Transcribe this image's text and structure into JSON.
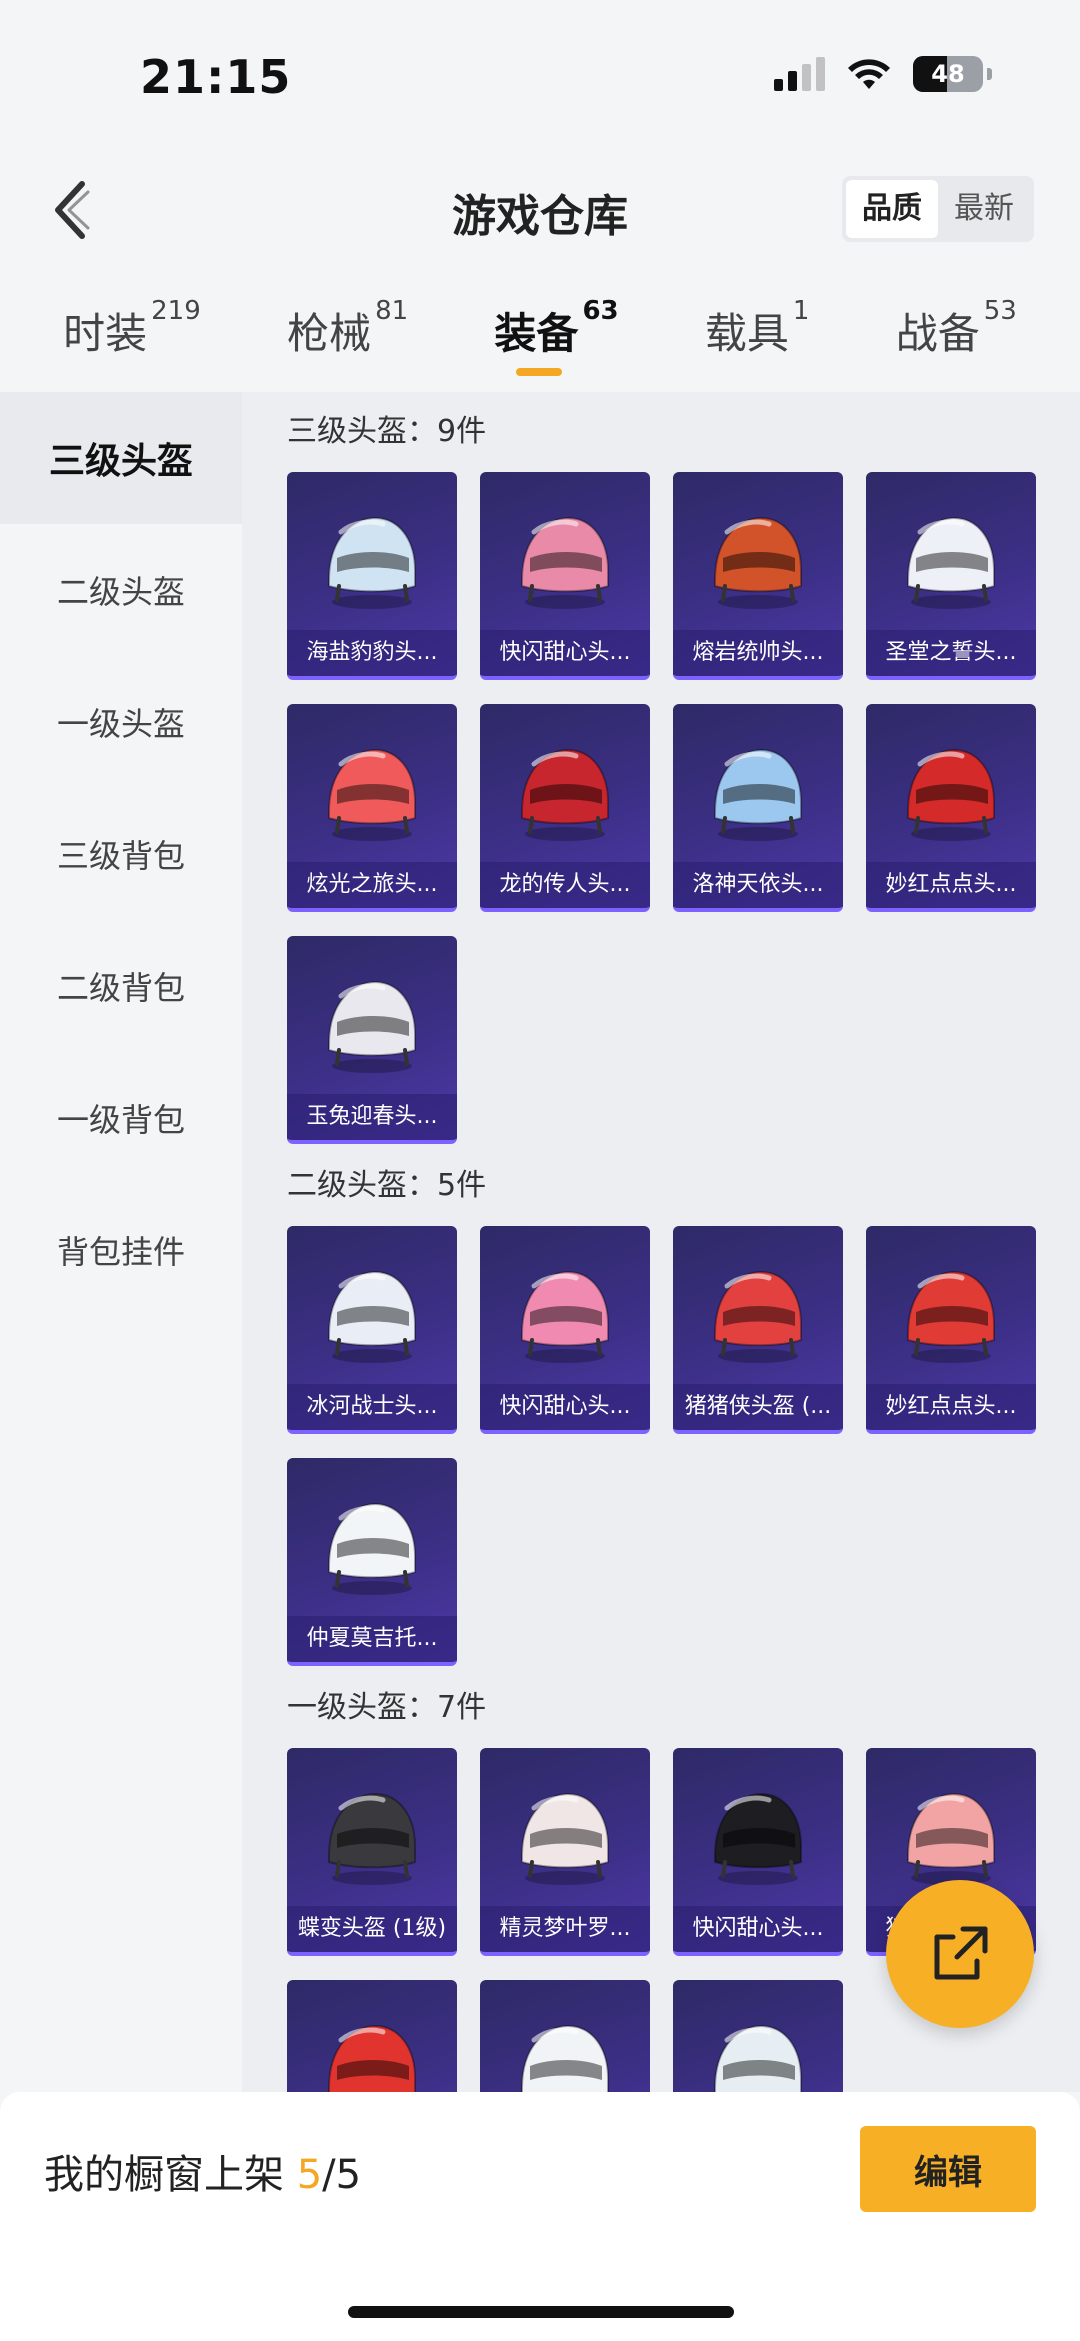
{
  "status_bar": {
    "time": "21:15",
    "battery": "48",
    "battery_level": 0.48
  },
  "header": {
    "title": "游戏仓库",
    "sort_options": [
      "品质",
      "最新"
    ],
    "sort_active": "品质"
  },
  "tabs": [
    {
      "label": "时装",
      "count": "219",
      "active": false
    },
    {
      "label": "枪械",
      "count": "81",
      "active": false
    },
    {
      "label": "装备",
      "count": "63",
      "active": true
    },
    {
      "label": "载具",
      "count": "1",
      "active": false
    },
    {
      "label": "战备",
      "count": "53",
      "active": false
    }
  ],
  "sidebar": {
    "items": [
      {
        "label": "三级头盔",
        "active": true
      },
      {
        "label": "二级头盔",
        "active": false
      },
      {
        "label": "一级头盔",
        "active": false
      },
      {
        "label": "三级背包",
        "active": false
      },
      {
        "label": "二级背包",
        "active": false
      },
      {
        "label": "一级背包",
        "active": false
      },
      {
        "label": "背包挂件",
        "active": false
      }
    ]
  },
  "sections": [
    {
      "title": "三级头盔：9件",
      "items": [
        {
          "name": "海盐豹豹头...",
          "color": "#cfe3f2"
        },
        {
          "name": "快闪甜心头...",
          "color": "#e98aa8"
        },
        {
          "name": "熔岩统帅头...",
          "color": "#d2522a"
        },
        {
          "name": "圣堂之誓头...",
          "color": "#eef0f8"
        },
        {
          "name": "炫光之旅头...",
          "color": "#f05a5a"
        },
        {
          "name": "龙的传人头...",
          "color": "#c8262e"
        },
        {
          "name": "洛神天依头...",
          "color": "#9cc7ee"
        },
        {
          "name": "妙红点点头...",
          "color": "#d42a2a"
        },
        {
          "name": "玉兔迎春头...",
          "color": "#e8e8ee"
        }
      ]
    },
    {
      "title": "二级头盔：5件",
      "items": [
        {
          "name": "冰河战士头...",
          "color": "#e9eef6"
        },
        {
          "name": "快闪甜心头...",
          "color": "#f08ab0"
        },
        {
          "name": "猪猪侠头盔 (...",
          "color": "#e34040"
        },
        {
          "name": "妙红点点头...",
          "color": "#e03b35"
        },
        {
          "name": "仲夏莫吉托...",
          "color": "#f2f5f7"
        }
      ]
    },
    {
      "title": "一级头盔：7件",
      "items": [
        {
          "name": "蝶变头盔 (1级)",
          "color": "#3a3a3e"
        },
        {
          "name": "精灵梦叶罗...",
          "color": "#f1e6e6"
        },
        {
          "name": "快闪甜心头...",
          "color": "#1e1e22"
        },
        {
          "name": "猪猪侠头盔...",
          "color": "#f2a3a3"
        },
        {
          "name": "",
          "color": "#e2342f"
        },
        {
          "name": "",
          "color": "#f1f4f6"
        },
        {
          "name": "",
          "color": "#e6eef4"
        }
      ]
    }
  ],
  "bottom": {
    "showcase_label": "我的橱窗上架",
    "showcase_current": "5",
    "showcase_total": "/5",
    "edit_label": "编辑"
  }
}
